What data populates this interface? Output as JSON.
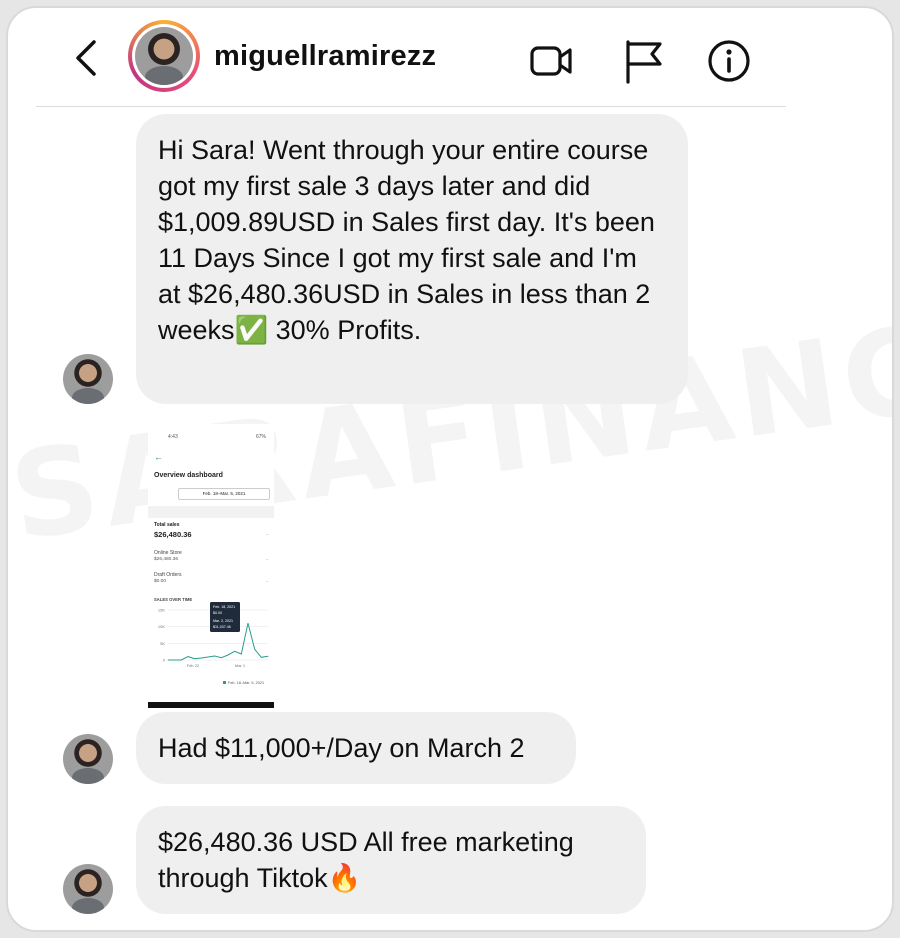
{
  "header": {
    "username": "miguellramirezz",
    "icons": [
      "back-icon",
      "video-call-icon",
      "flag-icon",
      "info-icon"
    ]
  },
  "watermark": "SARAFINANCE",
  "messages": [
    {
      "text": "Hi Sara! Went through your entire course got my first sale 3 days later and did $1,009.89USD in Sales first day. It's been 11 Days Since I got my first sale and I'm at $26,480.36USD in Sales in less than 2 weeks✅ 30% Profits."
    },
    {
      "text": "Had $11,000+/Day on March 2"
    },
    {
      "text": "$26,480.36 USD All free marketing through Tiktok🔥"
    }
  ],
  "attachment": {
    "status_time": "4:43",
    "status_battery": "67%",
    "title": "Overview dashboard",
    "date_range": "Feb. 18–Mar. 5, 2021",
    "total_sales_label": "Total sales",
    "total_sales_value": "$26,480.36",
    "online_store_label": "Online Store",
    "online_store_value": "$26,480.36",
    "draft_orders_label": "Draft Orders",
    "draft_orders_value": "$0.00",
    "chart_title": "SALES OVER TIME",
    "legend": "Feb. 18–Mar. 5, 2021",
    "tooltip_date_1": "Feb. 18, 2021",
    "tooltip_val_1": "$0.00",
    "tooltip_date_2": "Mar. 2, 2021",
    "tooltip_val_2": "$11,037.46",
    "chart_data": {
      "type": "line",
      "title": "SALES OVER TIME",
      "x_tick_labels": [
        "Feb 22",
        "Mar 1"
      ],
      "y_tick_labels": [
        "0",
        "5K",
        "10K",
        "15K"
      ],
      "ylim": [
        0,
        15000
      ],
      "accent": "#2a9d8f",
      "series": [
        {
          "values": [
            0,
            0,
            0,
            1009.89,
            400,
            600,
            900,
            1200,
            700,
            1500,
            2600,
            1800,
            11037.46,
            3200,
            800,
            1100
          ]
        }
      ]
    }
  }
}
